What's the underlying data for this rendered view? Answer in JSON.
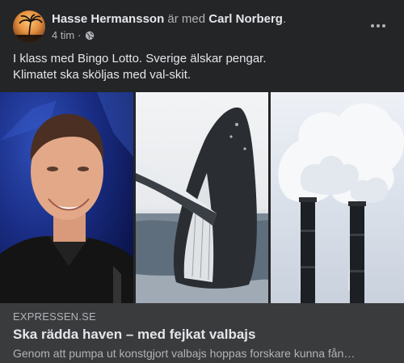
{
  "header": {
    "author": "Hasse Hermansson",
    "connector": " är med ",
    "tagged": "Carl Norberg",
    "end": ".",
    "time": "4 tim",
    "separator": "·",
    "privacy_icon": "globe-icon",
    "more_icon": "more-icon"
  },
  "post": {
    "line1": "I klass med Bingo Lotto. Sverige älskar pengar.",
    "line2": "Klimatet ska sköljas med val-skit."
  },
  "images": [
    {
      "name": "man-portrait-photo"
    },
    {
      "name": "whale-breach-photo"
    },
    {
      "name": "smokestacks-photo"
    }
  ],
  "link": {
    "domain": "EXPRESSEN.SE",
    "headline": "Ska rädda haven – med fejkat valbajs",
    "description": "Genom att pumpa ut konstgjort valbajs hoppas forskare kunna fån…"
  },
  "colors": {
    "background": "#242526",
    "link_box": "#3a3b3c",
    "primary_text": "#e4e6eb",
    "secondary_text": "#b0b3b8"
  }
}
